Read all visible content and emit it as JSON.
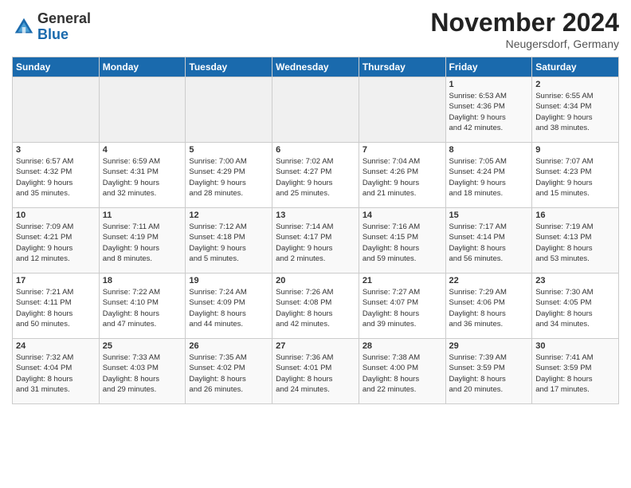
{
  "logo": {
    "general": "General",
    "blue": "Blue"
  },
  "title": "November 2024",
  "location": "Neugersdorf, Germany",
  "weekdays": [
    "Sunday",
    "Monday",
    "Tuesday",
    "Wednesday",
    "Thursday",
    "Friday",
    "Saturday"
  ],
  "weeks": [
    [
      {
        "day": "",
        "info": ""
      },
      {
        "day": "",
        "info": ""
      },
      {
        "day": "",
        "info": ""
      },
      {
        "day": "",
        "info": ""
      },
      {
        "day": "",
        "info": ""
      },
      {
        "day": "1",
        "info": "Sunrise: 6:53 AM\nSunset: 4:36 PM\nDaylight: 9 hours\nand 42 minutes."
      },
      {
        "day": "2",
        "info": "Sunrise: 6:55 AM\nSunset: 4:34 PM\nDaylight: 9 hours\nand 38 minutes."
      }
    ],
    [
      {
        "day": "3",
        "info": "Sunrise: 6:57 AM\nSunset: 4:32 PM\nDaylight: 9 hours\nand 35 minutes."
      },
      {
        "day": "4",
        "info": "Sunrise: 6:59 AM\nSunset: 4:31 PM\nDaylight: 9 hours\nand 32 minutes."
      },
      {
        "day": "5",
        "info": "Sunrise: 7:00 AM\nSunset: 4:29 PM\nDaylight: 9 hours\nand 28 minutes."
      },
      {
        "day": "6",
        "info": "Sunrise: 7:02 AM\nSunset: 4:27 PM\nDaylight: 9 hours\nand 25 minutes."
      },
      {
        "day": "7",
        "info": "Sunrise: 7:04 AM\nSunset: 4:26 PM\nDaylight: 9 hours\nand 21 minutes."
      },
      {
        "day": "8",
        "info": "Sunrise: 7:05 AM\nSunset: 4:24 PM\nDaylight: 9 hours\nand 18 minutes."
      },
      {
        "day": "9",
        "info": "Sunrise: 7:07 AM\nSunset: 4:23 PM\nDaylight: 9 hours\nand 15 minutes."
      }
    ],
    [
      {
        "day": "10",
        "info": "Sunrise: 7:09 AM\nSunset: 4:21 PM\nDaylight: 9 hours\nand 12 minutes."
      },
      {
        "day": "11",
        "info": "Sunrise: 7:11 AM\nSunset: 4:19 PM\nDaylight: 9 hours\nand 8 minutes."
      },
      {
        "day": "12",
        "info": "Sunrise: 7:12 AM\nSunset: 4:18 PM\nDaylight: 9 hours\nand 5 minutes."
      },
      {
        "day": "13",
        "info": "Sunrise: 7:14 AM\nSunset: 4:17 PM\nDaylight: 9 hours\nand 2 minutes."
      },
      {
        "day": "14",
        "info": "Sunrise: 7:16 AM\nSunset: 4:15 PM\nDaylight: 8 hours\nand 59 minutes."
      },
      {
        "day": "15",
        "info": "Sunrise: 7:17 AM\nSunset: 4:14 PM\nDaylight: 8 hours\nand 56 minutes."
      },
      {
        "day": "16",
        "info": "Sunrise: 7:19 AM\nSunset: 4:13 PM\nDaylight: 8 hours\nand 53 minutes."
      }
    ],
    [
      {
        "day": "17",
        "info": "Sunrise: 7:21 AM\nSunset: 4:11 PM\nDaylight: 8 hours\nand 50 minutes."
      },
      {
        "day": "18",
        "info": "Sunrise: 7:22 AM\nSunset: 4:10 PM\nDaylight: 8 hours\nand 47 minutes."
      },
      {
        "day": "19",
        "info": "Sunrise: 7:24 AM\nSunset: 4:09 PM\nDaylight: 8 hours\nand 44 minutes."
      },
      {
        "day": "20",
        "info": "Sunrise: 7:26 AM\nSunset: 4:08 PM\nDaylight: 8 hours\nand 42 minutes."
      },
      {
        "day": "21",
        "info": "Sunrise: 7:27 AM\nSunset: 4:07 PM\nDaylight: 8 hours\nand 39 minutes."
      },
      {
        "day": "22",
        "info": "Sunrise: 7:29 AM\nSunset: 4:06 PM\nDaylight: 8 hours\nand 36 minutes."
      },
      {
        "day": "23",
        "info": "Sunrise: 7:30 AM\nSunset: 4:05 PM\nDaylight: 8 hours\nand 34 minutes."
      }
    ],
    [
      {
        "day": "24",
        "info": "Sunrise: 7:32 AM\nSunset: 4:04 PM\nDaylight: 8 hours\nand 31 minutes."
      },
      {
        "day": "25",
        "info": "Sunrise: 7:33 AM\nSunset: 4:03 PM\nDaylight: 8 hours\nand 29 minutes."
      },
      {
        "day": "26",
        "info": "Sunrise: 7:35 AM\nSunset: 4:02 PM\nDaylight: 8 hours\nand 26 minutes."
      },
      {
        "day": "27",
        "info": "Sunrise: 7:36 AM\nSunset: 4:01 PM\nDaylight: 8 hours\nand 24 minutes."
      },
      {
        "day": "28",
        "info": "Sunrise: 7:38 AM\nSunset: 4:00 PM\nDaylight: 8 hours\nand 22 minutes."
      },
      {
        "day": "29",
        "info": "Sunrise: 7:39 AM\nSunset: 3:59 PM\nDaylight: 8 hours\nand 20 minutes."
      },
      {
        "day": "30",
        "info": "Sunrise: 7:41 AM\nSunset: 3:59 PM\nDaylight: 8 hours\nand 17 minutes."
      }
    ]
  ]
}
